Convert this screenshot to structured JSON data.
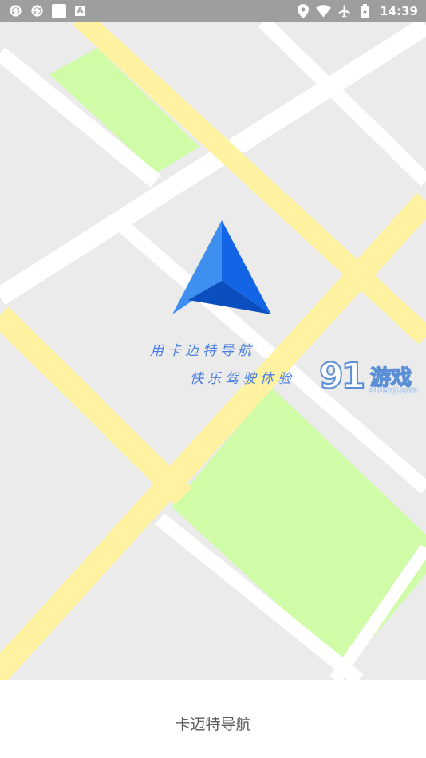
{
  "status_bar": {
    "time": "14:39",
    "left_icons": [
      "sync-icon",
      "sync-icon",
      "white-square-icon",
      "a-letter-icon"
    ],
    "left_letter": "A",
    "right_icons": [
      "location-pin-icon",
      "wifi-icon",
      "airplane-icon",
      "battery-icon"
    ],
    "color": "#9e9e9e"
  },
  "map": {
    "background_color": "#ebebeb",
    "road_color": "#ffffff",
    "main_road_color": "#fff2a0",
    "park_color": "#d0fca8"
  },
  "logo": {
    "icon": "navigation-arrow-icon",
    "colors": [
      "#3e8ff0",
      "#1464e6",
      "#0a4fbd"
    ]
  },
  "slogan": {
    "line1": "用卡迈特导航",
    "line2": "快乐驾驶体验",
    "color": "#4a7ee0"
  },
  "watermark": {
    "number": "91",
    "text": "游戏",
    "url": "91danji.com"
  },
  "bottom": {
    "app_name": "卡迈特导航"
  }
}
